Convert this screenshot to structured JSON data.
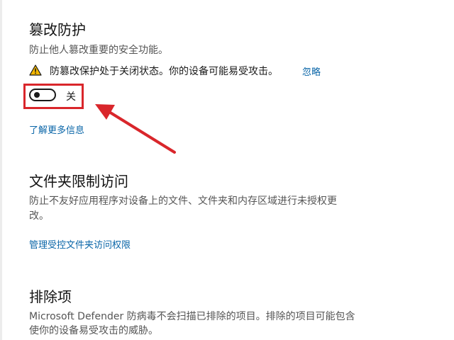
{
  "tamper": {
    "title": "篡改防护",
    "description": "防止他人篡改重要的安全功能。",
    "warning_text": "防篡改保护处于关闭状态。你的设备可能易受攻击。",
    "dismiss_label": "忽略",
    "toggle_state": "关",
    "toggle_on": false,
    "learn_more": "了解更多信息"
  },
  "folder_access": {
    "title": "文件夹限制访问",
    "description_line1": "防止不友好应用程序对设备上的文件、文件夹和内存区域进行未授权更",
    "description_line2": "改。",
    "manage_link": "管理受控文件夹访问权限"
  },
  "exclusions": {
    "title": "排除项",
    "description_line1": "Microsoft Defender 防病毒不会扫描已排除的项目。排除的项目可能包含",
    "description_line2": "使你的设备易受攻击的威胁。"
  },
  "colors": {
    "link": "#0a66a8",
    "highlight": "#d9262b",
    "warning": "#f2b600"
  }
}
